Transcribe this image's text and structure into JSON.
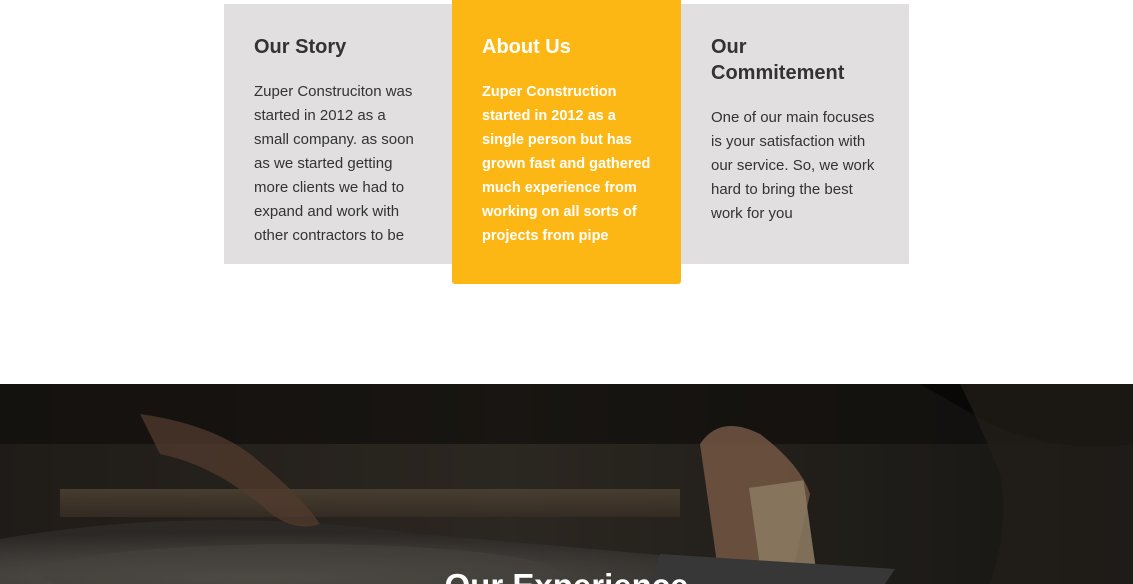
{
  "cards": [
    {
      "title": "Our Story",
      "body": "Zuper Construciton was started in 2012 as a small company. as soon as we started getting more clients we had to expand and work with other contractors to be"
    },
    {
      "title": "About Us",
      "body": "Zuper Construction started in 2012 as a single person but has grown fast and gathered much experience from working on all sorts of projects from pipe"
    },
    {
      "title": "Our Commitement",
      "body": "One of our main focuses is your satisfaction with our service. So, we work hard to bring the best work for you"
    }
  ],
  "experience": {
    "title": "Our Experience"
  },
  "colors": {
    "accent": "#fdb714",
    "card_grey": "#e1dfe0",
    "text_dark": "#333333"
  }
}
